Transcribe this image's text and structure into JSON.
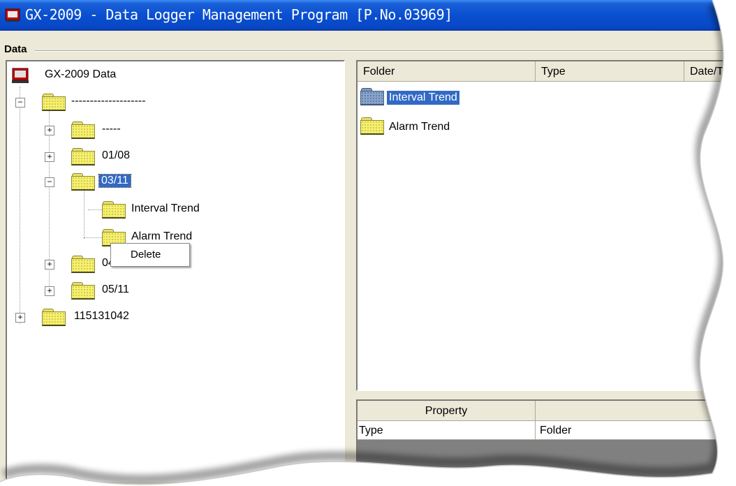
{
  "window": {
    "title": "GX-2009  - Data Logger Management Program [P.No.03969]"
  },
  "group": {
    "label": "Data"
  },
  "tree": {
    "root_label": "GX-2009 Data",
    "nodes": [
      {
        "label": "--------------------",
        "expanded": true
      },
      {
        "label": "-----",
        "expanded": false
      },
      {
        "label": "01/08",
        "expanded": false
      },
      {
        "label": "03/11",
        "expanded": true,
        "selected": true
      },
      {
        "label": "Interval Trend"
      },
      {
        "label": "Alarm Trend"
      },
      {
        "label": "04/11",
        "expanded": false
      },
      {
        "label": "05/11",
        "expanded": false
      },
      {
        "label": "115131042",
        "expanded": false
      }
    ]
  },
  "context_menu": {
    "delete_label": "Delete"
  },
  "list": {
    "columns": [
      "Folder",
      "Type",
      "Date/T"
    ],
    "items": [
      {
        "label": "Interval Trend",
        "selected": true
      },
      {
        "label": "Alarm Trend",
        "selected": false
      }
    ]
  },
  "property": {
    "header": "Property",
    "rows": [
      {
        "key": "Type",
        "value": "Folder"
      }
    ]
  },
  "colors": {
    "titlebar": "#0a4fd0",
    "selection": "#316ac5",
    "folder": "#f6f070",
    "face": "#ece9d8"
  }
}
